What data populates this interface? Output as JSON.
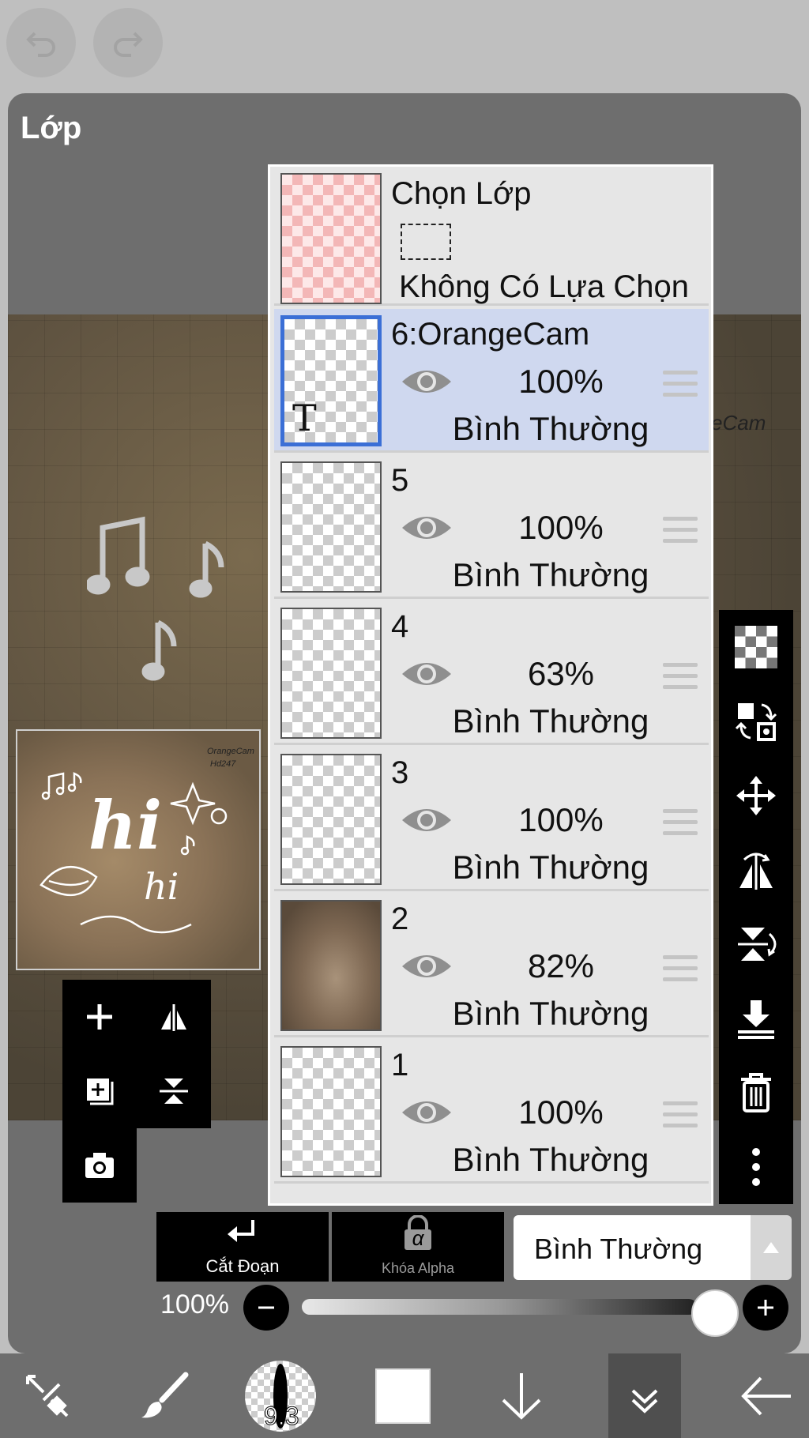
{
  "panel": {
    "title": "Lớp"
  },
  "selection_layer": {
    "title": "Chọn Lớp",
    "status": "Không Có Lựa Chọn"
  },
  "layers": [
    {
      "name": "6:OrangeCam",
      "opacity": "100%",
      "blend": "Bình Thường",
      "selected": true,
      "text_layer_glyph": "T"
    },
    {
      "name": "5",
      "opacity": "100%",
      "blend": "Bình Thường",
      "selected": false
    },
    {
      "name": "4",
      "opacity": "63%",
      "blend": "Bình Thường",
      "selected": false
    },
    {
      "name": "3",
      "opacity": "100%",
      "blend": "Bình Thường",
      "selected": false
    },
    {
      "name": "2",
      "opacity": "82%",
      "blend": "Bình Thường",
      "selected": false
    },
    {
      "name": "1",
      "opacity": "100%",
      "blend": "Bình Thường",
      "selected": false
    }
  ],
  "canvas_text": "eCam",
  "thumbnail": {
    "watermark_1": "OrangeCam",
    "watermark_2": "Hd247",
    "big_word": "hi",
    "small_word": "hi"
  },
  "bottom": {
    "clip_label": "Cắt Đoạn",
    "alpha_lock_label": "Khóa Alpha",
    "alpha_glyph": "α",
    "blend_mode": "Bình Thường",
    "opacity_label": "100%",
    "opacity_value": 1.0
  },
  "toolbar": {
    "brush_size": "9.3"
  },
  "colors": {
    "panel": "#6e6e6e",
    "list_bg": "#e6e6e6",
    "selected_row": "#cfd8ef",
    "selected_border": "#3b6fd6",
    "toolbar": "#000000"
  }
}
